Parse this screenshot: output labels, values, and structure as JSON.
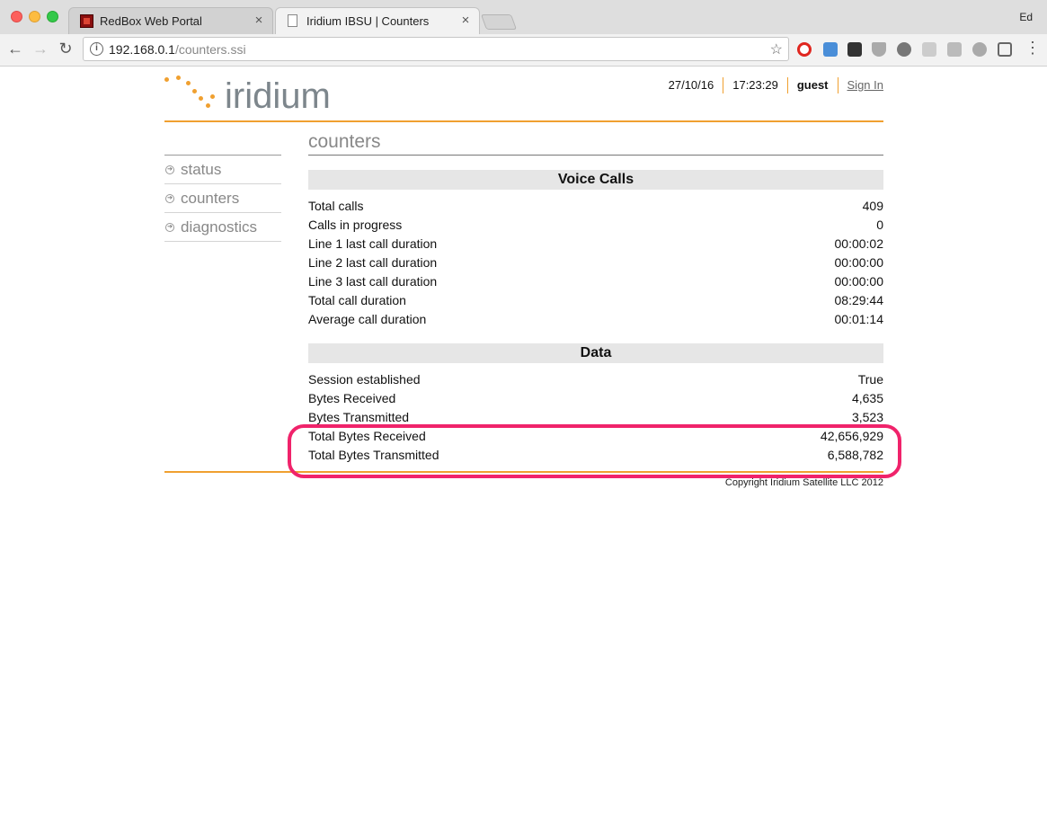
{
  "browser": {
    "tabs": [
      {
        "title": "RedBox Web Portal",
        "favicon": "redbox-favicon"
      },
      {
        "title": "Iridium IBSU | Counters",
        "favicon": "page-icon"
      }
    ],
    "profile_name": "Ed",
    "url_host": "192.168.0.1",
    "url_path": "/counters.ssi"
  },
  "header": {
    "logo_text": "iridium",
    "date": "27/10/16",
    "time": "17:23:29",
    "user": "guest",
    "sign_in": "Sign In"
  },
  "sidebar": {
    "items": [
      {
        "label": "status"
      },
      {
        "label": "counters"
      },
      {
        "label": "diagnostics"
      }
    ]
  },
  "main": {
    "title": "counters",
    "sections": [
      {
        "title": "Voice Calls",
        "rows": [
          {
            "label": "Total calls",
            "value": "409"
          },
          {
            "label": "Calls in progress",
            "value": "0"
          },
          {
            "label": "Line 1 last call duration",
            "value": "00:00:02"
          },
          {
            "label": "Line 2 last call duration",
            "value": "00:00:00"
          },
          {
            "label": "Line 3 last call duration",
            "value": "00:00:00"
          },
          {
            "label": "Total call duration",
            "value": "08:29:44"
          },
          {
            "label": "Average call duration",
            "value": "00:01:14"
          }
        ]
      },
      {
        "title": "Data",
        "rows": [
          {
            "label": "Session established",
            "value": "True"
          },
          {
            "label": "Bytes Received",
            "value": "4,635"
          },
          {
            "label": "Bytes Transmitted",
            "value": "3,523"
          },
          {
            "label": "Total Bytes Received",
            "value": "42,656,929"
          },
          {
            "label": "Total Bytes Transmitted",
            "value": "6,588,782"
          }
        ]
      }
    ]
  },
  "footer": {
    "copyright": "Copyright Iridium Satellite LLC 2012"
  },
  "colors": {
    "accent": "#f0a030",
    "highlight": "#f0236b",
    "logo_text": "#7d868c"
  }
}
